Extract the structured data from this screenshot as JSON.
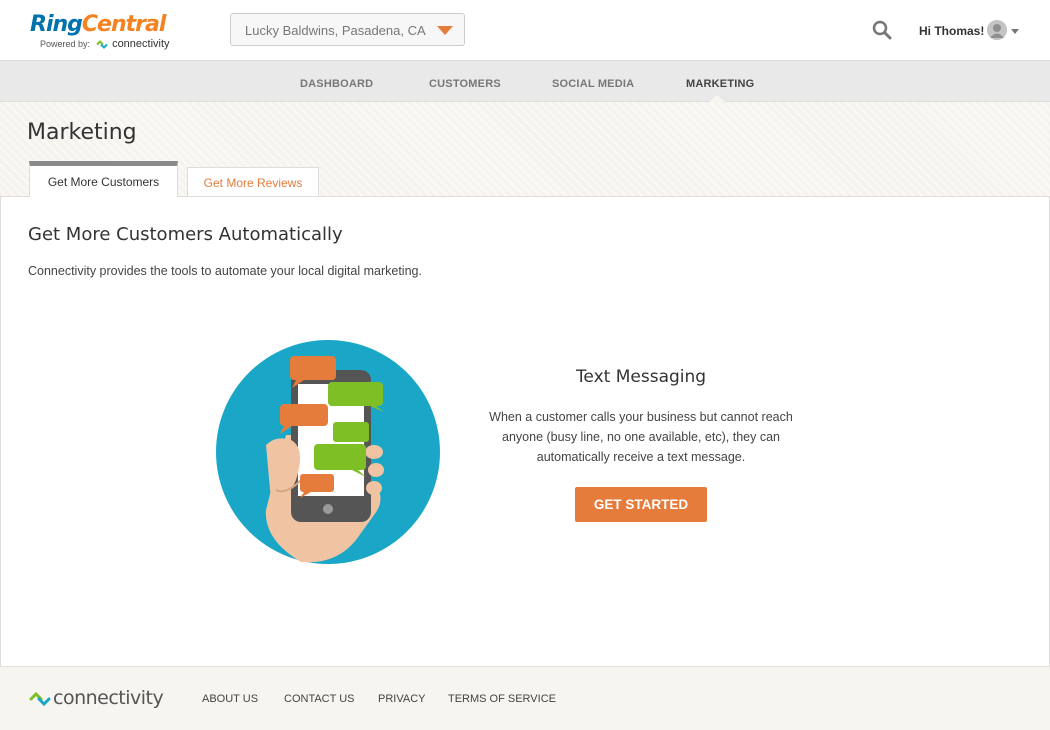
{
  "brand": {
    "logo_ring": "Ring",
    "logo_central": "Central",
    "powered_by": "Powered by:",
    "partner": "connectivity",
    "colors": {
      "blue": "#0073ae",
      "orange": "#f58220",
      "accent": "#e57c3c",
      "teal": "#1aa7c7",
      "green": "#7dbf24"
    }
  },
  "header": {
    "location": "Lucky Baldwins, Pasadena, CA",
    "greeting": "Hi Thomas!",
    "icons": {
      "search": "search-icon",
      "avatar": "user-avatar-icon",
      "caret": "chevron-down-icon"
    }
  },
  "nav": {
    "items": [
      {
        "label": "DASHBOARD"
      },
      {
        "label": "CUSTOMERS"
      },
      {
        "label": "SOCIAL MEDIA"
      },
      {
        "label": "MARKETING"
      }
    ],
    "active": "MARKETING"
  },
  "page": {
    "title": "Marketing",
    "tabs": [
      {
        "label": "Get More Customers",
        "active": true
      },
      {
        "label": "Get More Reviews",
        "active": false
      }
    ]
  },
  "main": {
    "heading": "Get More Customers Automatically",
    "description": "Connectivity provides the tools to automate your local digital marketing.",
    "feature": {
      "title": "Text Messaging",
      "description": "When a customer calls your business but cannot reach anyone (busy line, no one available, etc), they can automatically receive a text message.",
      "cta": "GET STARTED",
      "illustration_icon": "phone-messaging-illustration"
    }
  },
  "footer": {
    "logo_text": "connectivity",
    "links": [
      {
        "label": "ABOUT US"
      },
      {
        "label": "CONTACT US"
      },
      {
        "label": "PRIVACY"
      },
      {
        "label": "TERMS OF SERVICE"
      }
    ]
  }
}
